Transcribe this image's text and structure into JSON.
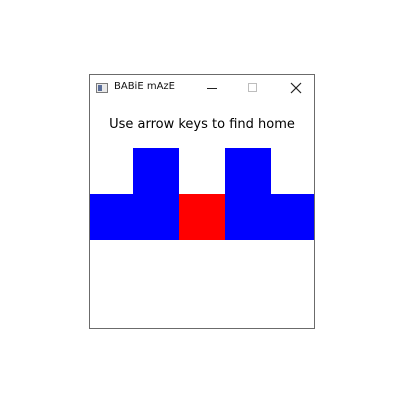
{
  "window": {
    "title": "BABiE mAzE",
    "icon": "app-window-icon",
    "controls": {
      "minimize": "minimize-icon",
      "maximize": "maximize-icon",
      "close": "close-icon"
    }
  },
  "game": {
    "instruction": "Use arrow keys to find home",
    "colors": {
      "wall": "#0000ff",
      "player": "#ff0000",
      "background": "#ffffff"
    }
  }
}
